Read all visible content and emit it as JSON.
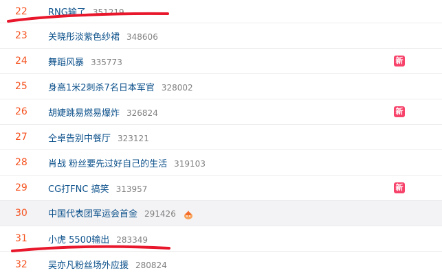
{
  "colors": {
    "rank": "#f5511e",
    "title": "#0a4f8a",
    "count": "#808080",
    "badge": "#f7426a",
    "highlight_row": "#f3f3f5",
    "annotation": "#e8172b"
  },
  "rows": [
    {
      "rank": "22",
      "title": "RNG输了",
      "count": "351219"
    },
    {
      "rank": "23",
      "title": "关晓彤淡紫色纱裙",
      "count": "348606"
    },
    {
      "rank": "24",
      "title": "舞蹈风暴",
      "count": "335773",
      "badge": "新"
    },
    {
      "rank": "25",
      "title": "身高1米2刺杀7名日本军官",
      "count": "328002"
    },
    {
      "rank": "26",
      "title": "胡婕跳易燃易爆炸",
      "count": "326824",
      "badge": "新"
    },
    {
      "rank": "27",
      "title": "仝卓告别中餐厅",
      "count": "323121"
    },
    {
      "rank": "28",
      "title": "肖战 粉丝要先过好自己的生活",
      "count": "319103"
    },
    {
      "rank": "29",
      "title": "CG打FNC 搞笑",
      "count": "313957",
      "badge": "新"
    },
    {
      "rank": "30",
      "title": "中国代表团军运会首金",
      "count": "291426",
      "icon": "fire-icon"
    },
    {
      "rank": "31",
      "title": "小虎 5500输出",
      "count": "283349"
    },
    {
      "rank": "32",
      "title": "吴亦凡粉丝场外应援",
      "count": "280824"
    }
  ]
}
